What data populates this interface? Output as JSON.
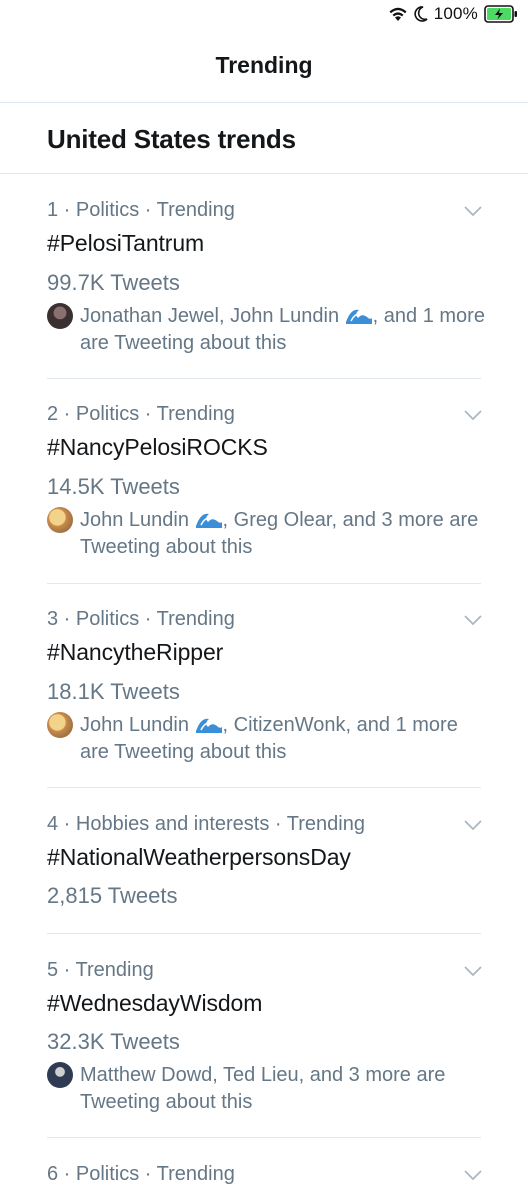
{
  "status_bar": {
    "battery_percent": "100%",
    "icons": [
      "wifi-icon",
      "moon-icon",
      "battery-charging-icon"
    ]
  },
  "nav": {
    "title": "Trending"
  },
  "section": {
    "title": "United States trends"
  },
  "trends": [
    {
      "meta": "1 · Politics · Trending",
      "name": "#PelosiTantrum",
      "count": "99.7K Tweets",
      "context_before": "Jonathan Jewel, John Lundin",
      "context_after": ", and 1 more are Tweeting about this",
      "avatar": "dark"
    },
    {
      "meta": "2 · Politics · Trending",
      "name": "#NancyPelosiROCKS",
      "count": "14.5K Tweets",
      "context_before": "John Lundin",
      "context_after": ", Greg Olear, and 3 more are Tweeting about this",
      "avatar": "food"
    },
    {
      "meta": "3 · Politics · Trending",
      "name": "#NancytheRipper",
      "count": "18.1K Tweets",
      "context_before": "John Lundin",
      "context_after": ", CitizenWonk, and 1 more are Tweeting about this",
      "avatar": "food"
    },
    {
      "meta": "4 · Hobbies and interests · Trending",
      "name": "#NationalWeatherpersonsDay",
      "count": "2,815 Tweets"
    },
    {
      "meta": "5 · Trending",
      "name": "#WednesdayWisdom",
      "count": "32.3K Tweets",
      "context_before": "Matthew Dowd, Ted Lieu, and 3 more are Tweeting about this",
      "context_after": "",
      "avatar": "man"
    },
    {
      "meta": "6 · Politics · Trending"
    }
  ],
  "colors": {
    "primary_text": "#14171a",
    "secondary_text": "#657786",
    "divider": "#e1e8ed",
    "battery_green": "#4cd964"
  }
}
